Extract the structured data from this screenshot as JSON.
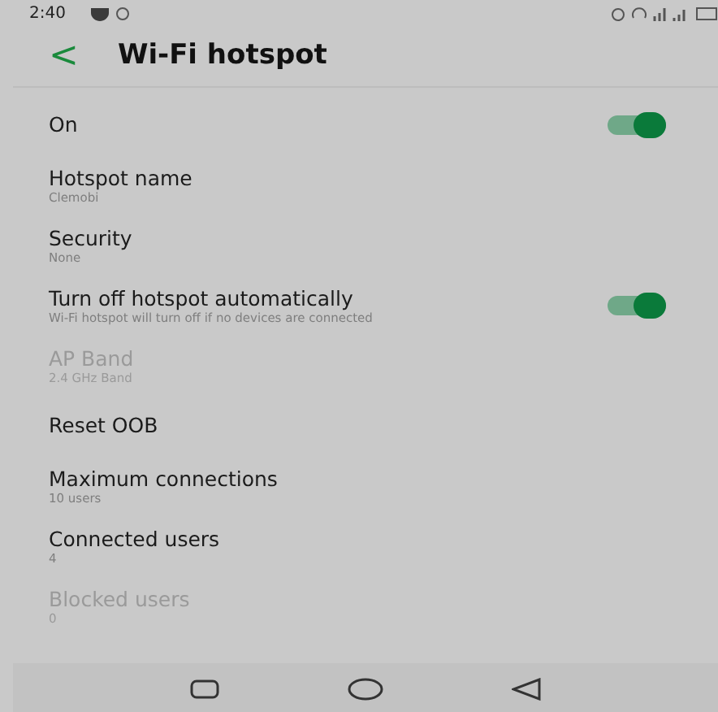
{
  "status_bar": {
    "time": "2:40"
  },
  "header": {
    "back": "<",
    "title": "Wi-Fi hotspot"
  },
  "settings": [
    {
      "kind": "toggle",
      "title": "On",
      "on": true,
      "disabled": false
    },
    {
      "kind": "plain",
      "title": "Hotspot name",
      "summary": "Clemobi",
      "disabled": false
    },
    {
      "kind": "plain",
      "title": "Security",
      "summary": "None",
      "disabled": false
    },
    {
      "kind": "toggle",
      "title": "Turn off hotspot automatically",
      "summary": "Wi-Fi hotspot will turn off if no devices are connected",
      "on": true,
      "disabled": false
    },
    {
      "kind": "plain",
      "title": "AP Band",
      "summary": "2.4 GHz Band",
      "disabled": true
    },
    {
      "kind": "plain",
      "title": "Reset OOB",
      "disabled": false
    },
    {
      "kind": "plain",
      "title": "Maximum connections",
      "summary": "10 users",
      "disabled": false
    },
    {
      "kind": "plain",
      "title": "Connected users",
      "summary": "4",
      "disabled": false
    },
    {
      "kind": "plain",
      "title": "Blocked users",
      "summary": "0",
      "disabled": true
    }
  ]
}
